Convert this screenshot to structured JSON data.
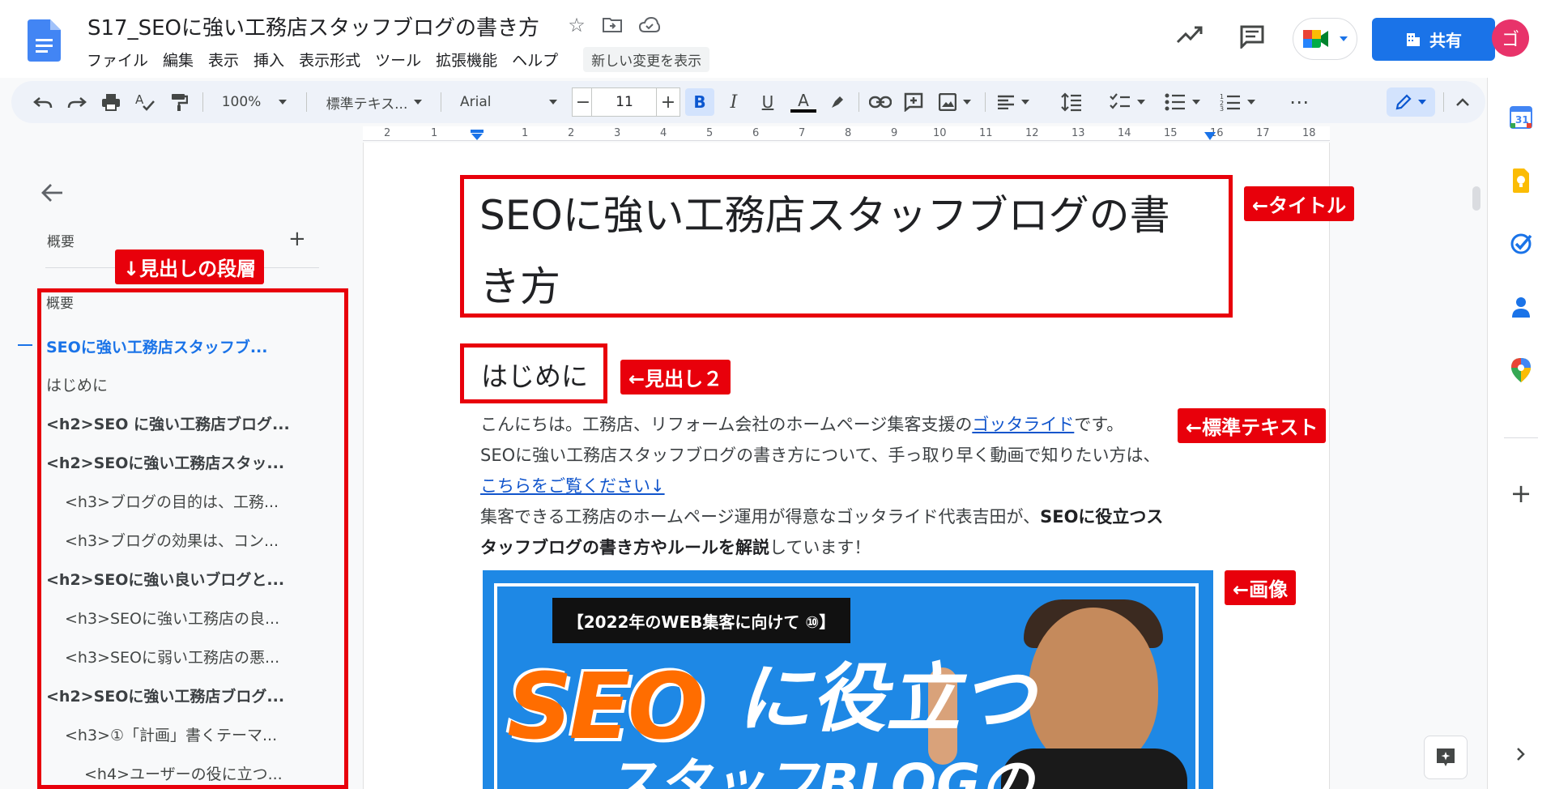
{
  "header": {
    "doc_title": "S17_SEOに強い工務店スタッフブログの書き方",
    "menu": [
      "ファイル",
      "編集",
      "表示",
      "挿入",
      "表示形式",
      "ツール",
      "拡張機能",
      "ヘルプ"
    ],
    "changes_label": "新しい変更を表示",
    "share_label": "共有",
    "avatar_initial": "ゴ"
  },
  "toolbar": {
    "zoom": "100%",
    "style": "標準テキス...",
    "font": "Arial",
    "font_size": "11",
    "bold_glyph": "B",
    "italic_glyph": "I",
    "underline_glyph": "U",
    "textcolor_glyph": "A"
  },
  "ruler": [
    "2",
    "1",
    "1",
    "2",
    "3",
    "4",
    "5",
    "6",
    "7",
    "8",
    "9",
    "10",
    "11",
    "12",
    "13",
    "14",
    "15",
    "16",
    "17",
    "18"
  ],
  "outline": {
    "section_label": "概要",
    "list_header": "概要",
    "items": [
      {
        "text": "SEOに強い工務店スタッフブ...",
        "level": 1,
        "active": true
      },
      {
        "text": "はじめに",
        "level": 1
      },
      {
        "text": "<h2>SEO に強い工務店ブログ...",
        "level": 2
      },
      {
        "text": "<h2>SEOに強い工務店スタッ...",
        "level": 2
      },
      {
        "text": "<h3>ブログの目的は、工務...",
        "level": 3
      },
      {
        "text": "<h3>ブログの効果は、コン...",
        "level": 3
      },
      {
        "text": "<h2>SEOに強い良いブログと...",
        "level": 2
      },
      {
        "text": "<h3>SEOに強い工務店の良...",
        "level": 3
      },
      {
        "text": "<h3>SEOに弱い工務店の悪...",
        "level": 3
      },
      {
        "text": "<h2>SEOに強い工務店ブログ...",
        "level": 2
      },
      {
        "text": "<h3>①「計画」書くテーマ...",
        "level": 3
      },
      {
        "text": "<h4>ユーザーの役に立つ...",
        "level": 4
      }
    ]
  },
  "document": {
    "title_line1": "SEOに強い工務店スタッフブログの書",
    "title_line2": "き方",
    "heading2": "はじめに",
    "p1_pre": "こんにちは。工務店、リフォーム会社のホームページ集客支援の",
    "p1_link": "ゴッタライド",
    "p1_post": "です。",
    "p2": "SEOに強い工務店スタッフブログの書き方について、手っ取り早く動画で知りたい方は、",
    "p3_link": "こちらをご覧ください↓",
    "p4_pre": "集客できる工務店のホームページ運用が得意なゴッタライド代表吉田が、",
    "p4_bold": "SEOに役立つス",
    "p5_bold": "タッフブログの書き方やルールを解説",
    "p5_post": "しています！"
  },
  "image": {
    "banner": "【2022年のWEB集客に向けて ⑩】",
    "seo": "SEO",
    "niyakudatsu": "に役立つ",
    "blog": "スタッフBLOGの"
  },
  "annotations": {
    "title": "←タイトル",
    "heading_level": "↓見出しの段層",
    "heading2": "←見出し２",
    "standard_text": "←標準テキスト",
    "image": "←画像"
  }
}
